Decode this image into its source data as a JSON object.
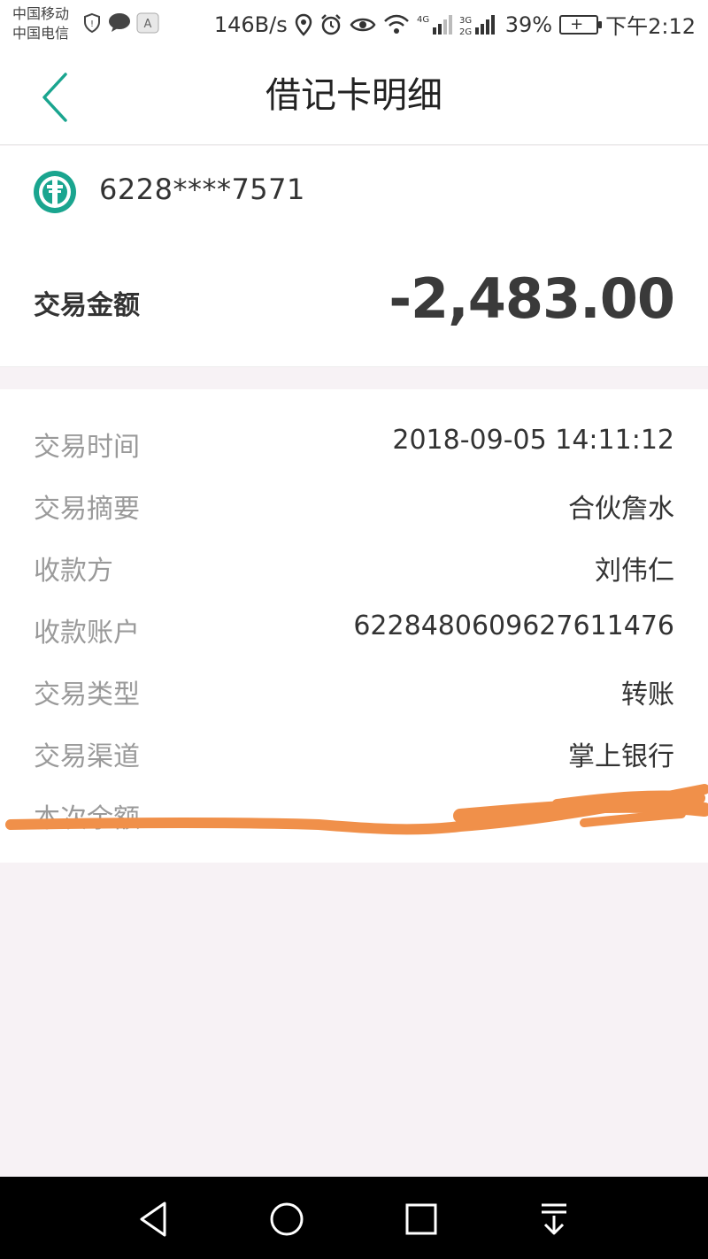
{
  "status_bar": {
    "carrier1": "中国移动",
    "carrier2": "中国电信",
    "net_speed": "146B/s",
    "battery": "39%",
    "time": "下午2:12",
    "signal_label_1": "4G",
    "signal_label_2": "3G",
    "signal_label_3": "2G"
  },
  "header": {
    "title": "借记卡明细",
    "back_icon": "chevron-left-icon"
  },
  "card": {
    "number": "6228****7571",
    "logo_icon": "bank-logo-icon",
    "amount_label": "交易金额",
    "amount": "-2,483.00"
  },
  "details": [
    {
      "label": "交易时间",
      "value": "2018-09-05 14:11:12"
    },
    {
      "label": "交易摘要",
      "value": "合伙詹水"
    },
    {
      "label": "收款方",
      "value": "刘伟仁"
    },
    {
      "label": "收款账户",
      "value": "6228480609627611476"
    },
    {
      "label": "交易类型",
      "value": "转账"
    },
    {
      "label": "交易渠道",
      "value": "掌上银行"
    },
    {
      "label": "本次余额",
      "value": ""
    }
  ],
  "colors": {
    "accent": "#1aa58f",
    "scribble": "#f0904a",
    "background": "#f7f2f5"
  },
  "navbar": {
    "back_icon": "triangle-back-icon",
    "home_icon": "circle-home-icon",
    "recents_icon": "square-recents-icon",
    "notifications_icon": "pull-down-icon"
  }
}
